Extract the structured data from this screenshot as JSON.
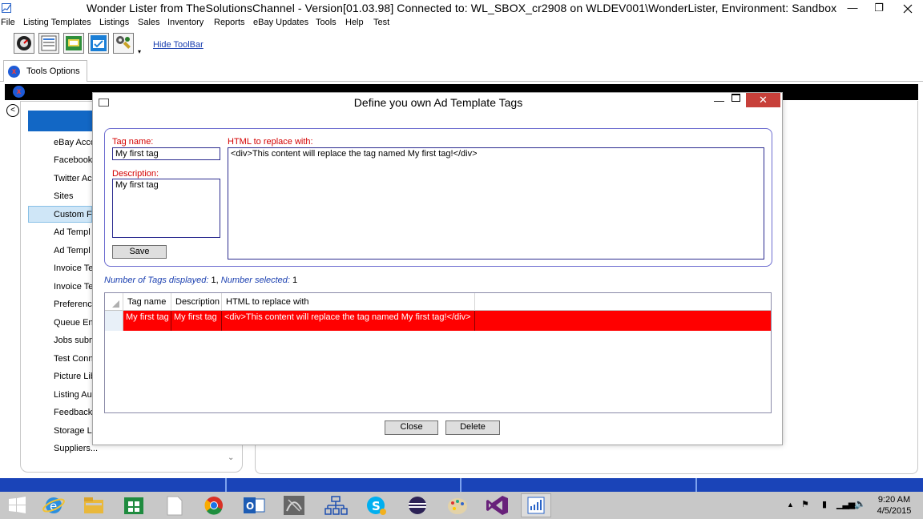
{
  "window": {
    "title": "Wonder Lister from TheSolutionsChannel - Version[01.03.98] Connected to: WL_SBOX_cr2908 on WLDEV001\\WonderLister, Environment: Sandbox",
    "minimize": "—",
    "restore": "❐"
  },
  "menu": [
    "File",
    "Listing Templates",
    "Listings",
    "Sales",
    "Inventory",
    "Reports",
    "eBay Updates",
    "Tools",
    "Help",
    "Test"
  ],
  "toolbar": {
    "hide_label": "Hide ToolBar",
    "dropdown_glyph": "▾"
  },
  "tab": {
    "label": "Tools Options",
    "close": "x"
  },
  "header_close": "x",
  "left_nav": {
    "back": "<",
    "items": [
      "eBay Acco",
      "Facebook",
      "Twitter Ac",
      "Sites",
      "Custom Fi",
      "Ad Templ",
      "Ad Templ",
      "Invoice Te",
      "Invoice Te",
      "Preference",
      "Queue Ent",
      "Jobs subm",
      "Test Conn",
      "Picture Lib",
      "Listing Au",
      "Feedback",
      "Storage Lo",
      "Suppliers..."
    ],
    "scroll_down": "⌄"
  },
  "dialog": {
    "title": "Define you own Ad Template Tags",
    "min": "—",
    "close": "✕",
    "tag_name_label": "Tag name:",
    "tag_name_value": "My first tag",
    "description_label": "Description:",
    "description_value": "My first tag",
    "html_label": "HTML to replace with:",
    "html_value": "<div>This content will replace the tag named My first tag!</div>",
    "save_button": "Save",
    "summary": {
      "displayed_label": "Number of Tags displayed:",
      "displayed_value": "1,",
      "selected_label": "Number selected:",
      "selected_value": "1"
    },
    "grid": {
      "columns": [
        "Tag name",
        "Description",
        "HTML to replace with"
      ],
      "rows": [
        [
          "My first tag",
          "My first tag",
          "<div>This content will replace the tag named My first tag!</div>"
        ]
      ]
    },
    "close_button": "Close",
    "delete_button": "Delete"
  },
  "clock": {
    "time": "9:20 AM",
    "date": "4/5/2015"
  },
  "colors": {
    "status_bar": "#1a44b8",
    "selected_row": "#ff0000",
    "dialog_close": "#c7403a",
    "nav_header": "#1267c5"
  }
}
